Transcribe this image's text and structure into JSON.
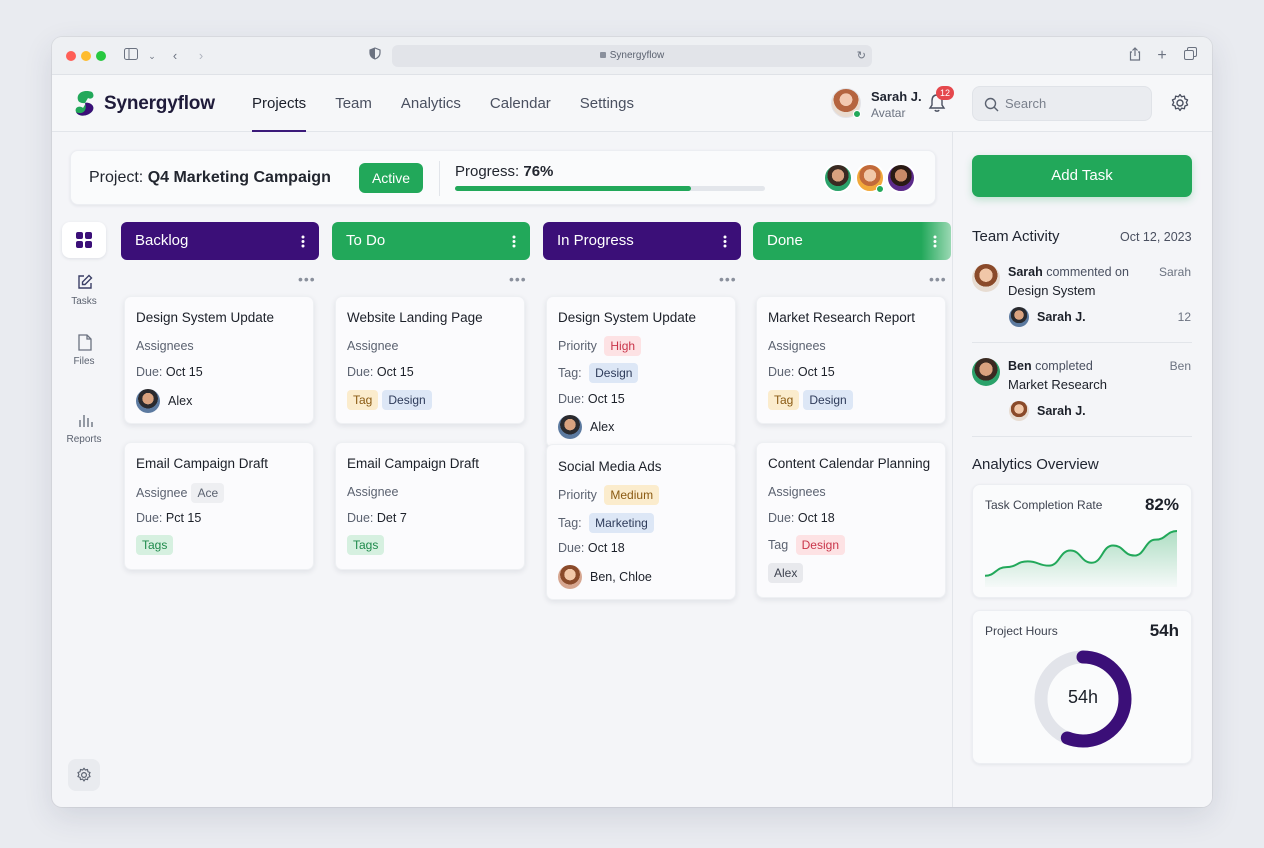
{
  "browser": {
    "url": "Synergyflow"
  },
  "app": {
    "brand": "Synergyflow",
    "nav": [
      "Projects",
      "Team",
      "Analytics",
      "Calendar",
      "Settings"
    ],
    "user": {
      "name": "Sarah J.",
      "subtitle": "Avatar"
    },
    "notifications": "12",
    "search_placeholder": "Search"
  },
  "project": {
    "prefix": "Project: ",
    "name": "Q4 Marketing Campaign",
    "status": "Active",
    "progress_label": "Progress: ",
    "progress_value": "76%",
    "progress_fraction": 0.76
  },
  "sidebar": {
    "items": [
      {
        "label": "",
        "icon": "grid-icon"
      },
      {
        "label": "Tasks",
        "icon": "edit-icon"
      },
      {
        "label": "Files",
        "icon": "file-icon"
      },
      {
        "label": "Reports",
        "icon": "bar-chart-icon"
      }
    ]
  },
  "columns": [
    {
      "title": "Backlog",
      "color": "#3b0f78",
      "cards": [
        {
          "title": "Design System Update",
          "rows": [
            {
              "t": "Assignees"
            },
            {
              "t": "Due:",
              "v": "Oct 15"
            }
          ],
          "assignee": "Alex"
        },
        {
          "title": "Email Campaign Draft",
          "rows": [
            {
              "t": "Assignee",
              "pill": "Ace"
            },
            {
              "t": "Due:",
              "v": "Pct 15"
            }
          ],
          "tag": "Tags"
        }
      ]
    },
    {
      "title": "To Do",
      "color": "#22a85a",
      "cards": [
        {
          "title": "Website Landing Page",
          "rows": [
            {
              "t": "Assignee"
            },
            {
              "t": "Due:",
              "v": "Oct 15"
            }
          ],
          "tags": [
            "Tag",
            "Design"
          ]
        },
        {
          "title": "Email Campaign Draft",
          "rows": [
            {
              "t": "Assignee"
            },
            {
              "t": "Due:",
              "v": "Det 7"
            }
          ],
          "tag": "Tags"
        }
      ]
    },
    {
      "title": "In Progress",
      "color": "#3b0f78",
      "cards": [
        {
          "title": "Design System Update",
          "priority_label": "Priority",
          "priority": "High",
          "tag_label": "Tag:",
          "tag": "Design",
          "due_label": "Due:",
          "due": "Oct 15",
          "assignee": "Alex"
        },
        {
          "title": "Social Media Ads",
          "priority_label": "Priority",
          "priority": "Medium",
          "tag_label": "Tag:",
          "tag": "Marketing",
          "due_label": "Due:",
          "due": "Oct 18",
          "assignee": "Ben, Chloe"
        }
      ]
    },
    {
      "title": "Done",
      "color": "#22a85a",
      "cards": [
        {
          "title": "Market Research Report",
          "rows": [
            {
              "t": "Assignees"
            },
            {
              "t": "Due:",
              "v": "Oct 15"
            }
          ],
          "tags": [
            "Tag",
            "Design"
          ]
        },
        {
          "title": "Content Calendar Planning",
          "rows": [
            {
              "t": "Assignees"
            },
            {
              "t": "Due:",
              "v": "Oct 18"
            }
          ],
          "tag_label": "Tag",
          "tag": "Design",
          "extra": "Alex"
        }
      ]
    }
  ],
  "more_symbol": "•••",
  "right": {
    "add_task": "Add Task",
    "activity_title": "Team Activity",
    "activity_date": "Oct 12, 2023",
    "activities": [
      {
        "actor": "Sarah",
        "verb": " commented on",
        "object": "Design System",
        "right": "Sarah",
        "sub_name": "Sarah J.",
        "sub_right": "12"
      },
      {
        "actor": "Ben",
        "verb": " completed",
        "object": "Market Research",
        "right": "Ben",
        "sub_name": "Sarah J.",
        "sub_right": ""
      }
    ],
    "analytics_title": "Analytics Overview",
    "completion": {
      "label": "Task Completion Rate",
      "value": "82%",
      "trend": [
        10,
        22,
        30,
        24,
        45,
        28,
        52,
        38,
        60,
        72
      ]
    },
    "hours": {
      "label": "Project Hours",
      "value": "54h",
      "center": "54h",
      "fraction": 0.56
    }
  },
  "colors": {
    "purple": "#3b0f78",
    "green": "#22a85a",
    "red": "#e5484d"
  }
}
